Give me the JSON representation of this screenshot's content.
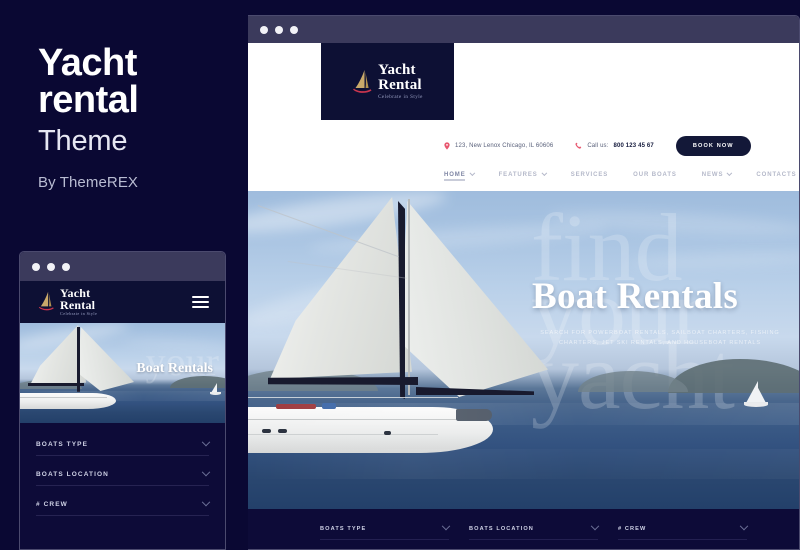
{
  "promo": {
    "title_line1": "Yacht",
    "title_line2": "rental",
    "subtitle": "Theme",
    "byline": "By ThemeREX"
  },
  "brand": {
    "name_line1": "Yacht",
    "name_line2": "Rental",
    "tagline": "Celebrate in Style",
    "logo_icon": "sailboat-icon"
  },
  "colors": {
    "page_background": "#0a0833",
    "chrome_bar": "#3b3a5c",
    "brand_navy": "#0d1034",
    "accent_pink": "#e8576f",
    "logo_gold": "#c9a96a"
  },
  "desktop": {
    "chrome": {
      "dots": 3
    },
    "contact": {
      "address_icon": "map-pin-icon",
      "address": "123, New Lenox Chicago, IL 60606",
      "phone_icon": "phone-icon",
      "phone_label": "Call us:",
      "phone_number": "800 123 45 67",
      "book_button": "BOOK NOW"
    },
    "nav": [
      {
        "label": "HOME",
        "has_dropdown": true,
        "active": true
      },
      {
        "label": "FEATURES",
        "has_dropdown": true,
        "active": false
      },
      {
        "label": "SERVICES",
        "has_dropdown": false,
        "active": false
      },
      {
        "label": "OUR BOATS",
        "has_dropdown": false,
        "active": false
      },
      {
        "label": "NEWS",
        "has_dropdown": true,
        "active": false
      },
      {
        "label": "CONTACTS",
        "has_dropdown": false,
        "active": false
      }
    ],
    "hero": {
      "watermark_line1": "find",
      "watermark_line2": "your",
      "watermark_line3": "yacht",
      "heading": "Boat Rentals",
      "subtitle": "SEARCH FOR POWERBOAT RENTALS, SAILBOAT CHARTERS, FISHING CHARTERS, JET SKI RENTALS, AND HOUSEBOAT RENTALS"
    },
    "search": {
      "fields": [
        {
          "label": "BOATS TYPE"
        },
        {
          "label": "BOATS LOCATION"
        },
        {
          "label": "# CREW"
        }
      ]
    }
  },
  "mobile": {
    "chrome": {
      "dots": 3
    },
    "menu_icon": "hamburger-menu-icon",
    "hero": {
      "heading": "Boat Rentals"
    },
    "search": {
      "fields": [
        {
          "label": "BOATS TYPE"
        },
        {
          "label": "BOATS LOCATION"
        },
        {
          "label": "# CREW"
        }
      ]
    }
  }
}
